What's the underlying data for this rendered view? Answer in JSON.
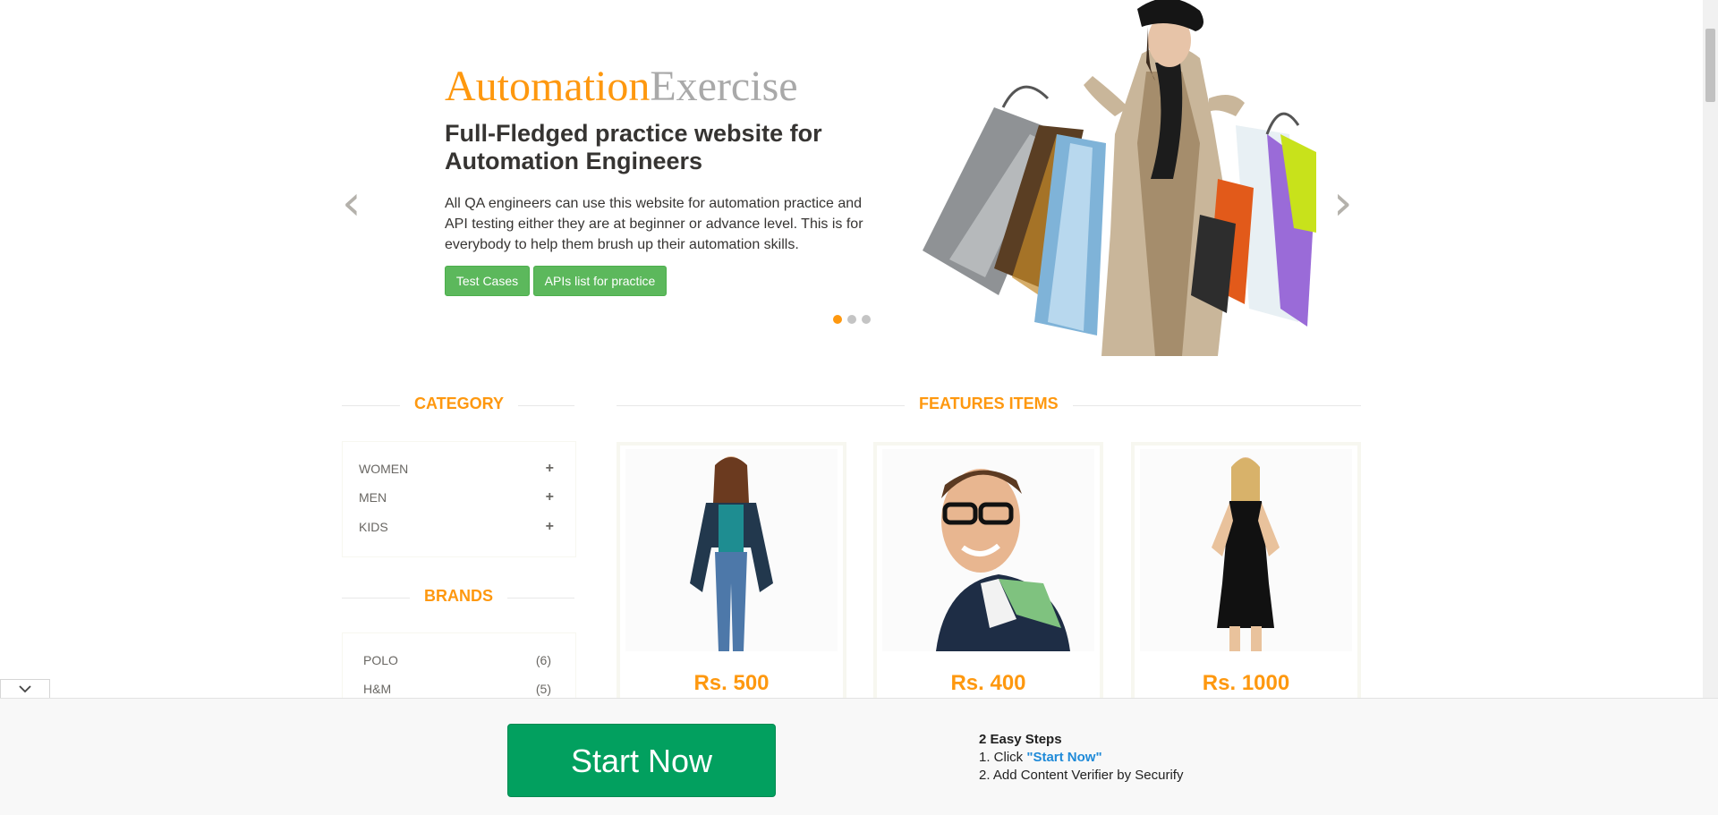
{
  "slider": {
    "brand_part1": "Automation",
    "brand_part2": "Exercise",
    "headline": "Full-Fledged practice website for Automation Engineers",
    "description": "All QA engineers can use this website for automation practice and API testing either they are at beginner or advance level. This is for everybody to help them brush up their automation skills.",
    "button_test_cases": "Test Cases",
    "button_apis": "APIs list for practice",
    "prev_icon": "chevron-left-icon",
    "next_icon": "chevron-right-icon",
    "active_slide": 1,
    "slide_count": 3
  },
  "sidebar": {
    "category_title": "CATEGORY",
    "categories": [
      {
        "label": "WOMEN"
      },
      {
        "label": "MEN"
      },
      {
        "label": "KIDS"
      }
    ],
    "brands_title": "BRANDS",
    "brands": [
      {
        "label": "POLO",
        "count": "(6)"
      },
      {
        "label": "H&M",
        "count": "(5)"
      }
    ]
  },
  "features": {
    "title": "FEATURES ITEMS",
    "products": [
      {
        "price": "Rs. 500"
      },
      {
        "price": "Rs. 400"
      },
      {
        "price": "Rs. 1000"
      }
    ]
  },
  "ad_banner": {
    "start_button": "Start Now",
    "steps_title": "2 Easy Steps",
    "step1_prefix": "1. Click ",
    "step1_highlight": "\"Start Now\"",
    "step2": "2. Add Content Verifier by Securify"
  },
  "colors": {
    "accent": "#FE980F",
    "button_green": "#5CB85C",
    "start_green": "#02A05F"
  }
}
